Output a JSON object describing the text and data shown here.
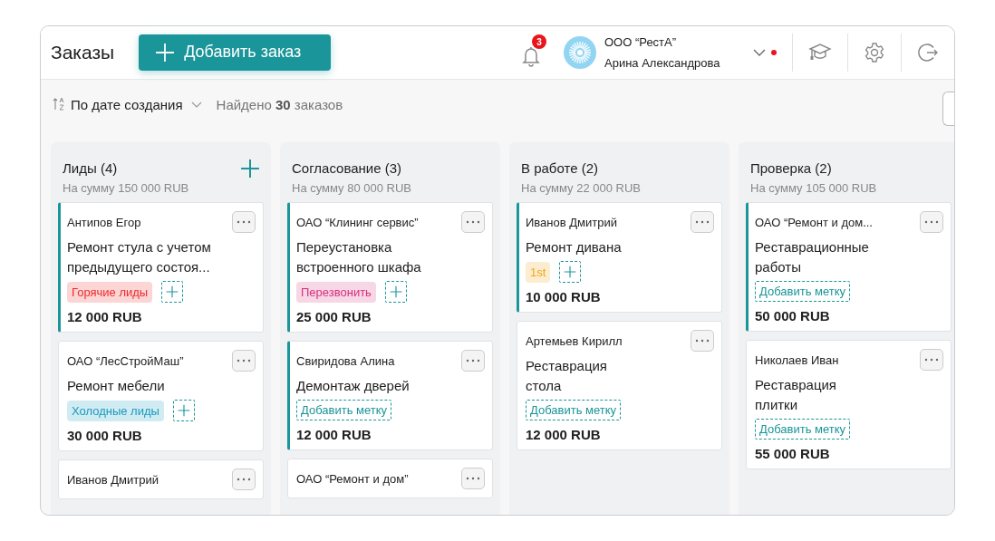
{
  "header": {
    "title": "Заказы",
    "add_button": "Добавить заказ",
    "notifications": {
      "count": "3"
    },
    "account": {
      "company": "ООО “РестА”",
      "user": "Арина Александрова",
      "status_dot": true
    }
  },
  "toolbar": {
    "sort": "По дате создания",
    "found": "Найдено **30** заказов"
  },
  "columns": [
    {
      "title": "Лиды (4)",
      "sum": "На сумму 150 000 RUB",
      "can_add": true,
      "cards": [
        {
          "client": "Антипов Егор",
          "title": "Ремонт стула с учетом\nпредыдущего состоя...",
          "tag": {
            "label": "Горячие лиды",
            "color": "#ef2b2b"
          },
          "amount": "12 000 RUB",
          "highlighted": true
        },
        {
          "client": "ОАО “ЛесСтройМаш”",
          "title": "Ремонт мебели",
          "tag": {
            "label": "Холодные лиды",
            "color": "#1a9abf"
          },
          "amount": "30 000 RUB",
          "highlighted": false
        },
        {
          "client": "Иванов Дмитрий",
          "highlighted": false
        }
      ]
    },
    {
      "title": "Согласование (3)",
      "sum": "На сумму 80 000 RUB",
      "can_add": false,
      "cards": [
        {
          "client": "ОАО “Клининг сервис”",
          "title": "Переустановка\nвстроенного шкафа",
          "tag": {
            "label": "Перезвонить",
            "color": "#d8307e"
          },
          "amount": "25 000 RUB",
          "highlighted": true
        },
        {
          "client": "Свиридова Алина",
          "title": "Демонтаж дверей",
          "add_label": "Добавить метку",
          "amount": "12 000 RUB",
          "highlighted": true
        },
        {
          "client": "ОАО “Ремонт и дом”",
          "highlighted": false
        }
      ]
    },
    {
      "title": "В работе (2)",
      "sum": "На сумму 22 000 RUB",
      "can_add": false,
      "cards": [
        {
          "client": "Иванов Дмитрий",
          "title": "Ремонт дивана",
          "tag": {
            "label": "1st",
            "color": "#f2a516"
          },
          "amount": "10 000 RUB",
          "highlighted": true
        },
        {
          "client": "Артемьев Кирилл",
          "title": "Реставрация\nстола",
          "add_label": "Добавить метку",
          "amount": "12 000 RUB",
          "highlighted": false
        }
      ]
    },
    {
      "title": "Проверка (2)",
      "sum": "На сумму 105 000 RUB",
      "can_add": false,
      "cards": [
        {
          "client": "ОАО “Ремонт и дом...",
          "title": "Реставрационные\nработы",
          "add_label": "Добавить метку",
          "amount": "50 000 RUB",
          "highlighted": true
        },
        {
          "client": "Николаев Иван",
          "title": "Реставрация\nплитки",
          "add_label": "Добавить метку",
          "amount": "55 000 RUB",
          "highlighted": false
        }
      ]
    }
  ]
}
